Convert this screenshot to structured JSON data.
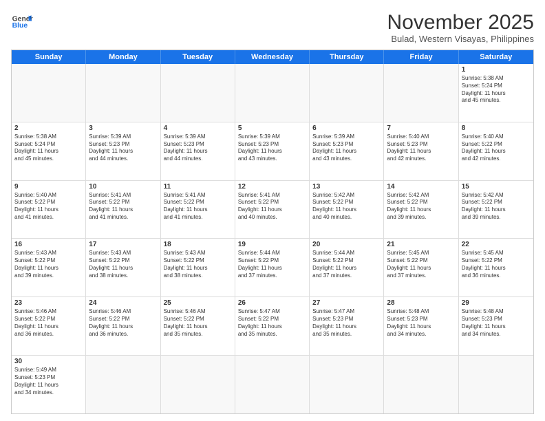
{
  "header": {
    "logo_general": "General",
    "logo_blue": "Blue",
    "month_title": "November 2025",
    "subtitle": "Bulad, Western Visayas, Philippines"
  },
  "weekdays": [
    "Sunday",
    "Monday",
    "Tuesday",
    "Wednesday",
    "Thursday",
    "Friday",
    "Saturday"
  ],
  "rows": [
    [
      {
        "day": "",
        "text": ""
      },
      {
        "day": "",
        "text": ""
      },
      {
        "day": "",
        "text": ""
      },
      {
        "day": "",
        "text": ""
      },
      {
        "day": "",
        "text": ""
      },
      {
        "day": "",
        "text": ""
      },
      {
        "day": "1",
        "text": "Sunrise: 5:38 AM\nSunset: 5:24 PM\nDaylight: 11 hours\nand 45 minutes."
      }
    ],
    [
      {
        "day": "2",
        "text": "Sunrise: 5:38 AM\nSunset: 5:24 PM\nDaylight: 11 hours\nand 45 minutes."
      },
      {
        "day": "3",
        "text": "Sunrise: 5:39 AM\nSunset: 5:23 PM\nDaylight: 11 hours\nand 44 minutes."
      },
      {
        "day": "4",
        "text": "Sunrise: 5:39 AM\nSunset: 5:23 PM\nDaylight: 11 hours\nand 44 minutes."
      },
      {
        "day": "5",
        "text": "Sunrise: 5:39 AM\nSunset: 5:23 PM\nDaylight: 11 hours\nand 43 minutes."
      },
      {
        "day": "6",
        "text": "Sunrise: 5:39 AM\nSunset: 5:23 PM\nDaylight: 11 hours\nand 43 minutes."
      },
      {
        "day": "7",
        "text": "Sunrise: 5:40 AM\nSunset: 5:23 PM\nDaylight: 11 hours\nand 42 minutes."
      },
      {
        "day": "8",
        "text": "Sunrise: 5:40 AM\nSunset: 5:22 PM\nDaylight: 11 hours\nand 42 minutes."
      }
    ],
    [
      {
        "day": "9",
        "text": "Sunrise: 5:40 AM\nSunset: 5:22 PM\nDaylight: 11 hours\nand 41 minutes."
      },
      {
        "day": "10",
        "text": "Sunrise: 5:41 AM\nSunset: 5:22 PM\nDaylight: 11 hours\nand 41 minutes."
      },
      {
        "day": "11",
        "text": "Sunrise: 5:41 AM\nSunset: 5:22 PM\nDaylight: 11 hours\nand 41 minutes."
      },
      {
        "day": "12",
        "text": "Sunrise: 5:41 AM\nSunset: 5:22 PM\nDaylight: 11 hours\nand 40 minutes."
      },
      {
        "day": "13",
        "text": "Sunrise: 5:42 AM\nSunset: 5:22 PM\nDaylight: 11 hours\nand 40 minutes."
      },
      {
        "day": "14",
        "text": "Sunrise: 5:42 AM\nSunset: 5:22 PM\nDaylight: 11 hours\nand 39 minutes."
      },
      {
        "day": "15",
        "text": "Sunrise: 5:42 AM\nSunset: 5:22 PM\nDaylight: 11 hours\nand 39 minutes."
      }
    ],
    [
      {
        "day": "16",
        "text": "Sunrise: 5:43 AM\nSunset: 5:22 PM\nDaylight: 11 hours\nand 39 minutes."
      },
      {
        "day": "17",
        "text": "Sunrise: 5:43 AM\nSunset: 5:22 PM\nDaylight: 11 hours\nand 38 minutes."
      },
      {
        "day": "18",
        "text": "Sunrise: 5:43 AM\nSunset: 5:22 PM\nDaylight: 11 hours\nand 38 minutes."
      },
      {
        "day": "19",
        "text": "Sunrise: 5:44 AM\nSunset: 5:22 PM\nDaylight: 11 hours\nand 37 minutes."
      },
      {
        "day": "20",
        "text": "Sunrise: 5:44 AM\nSunset: 5:22 PM\nDaylight: 11 hours\nand 37 minutes."
      },
      {
        "day": "21",
        "text": "Sunrise: 5:45 AM\nSunset: 5:22 PM\nDaylight: 11 hours\nand 37 minutes."
      },
      {
        "day": "22",
        "text": "Sunrise: 5:45 AM\nSunset: 5:22 PM\nDaylight: 11 hours\nand 36 minutes."
      }
    ],
    [
      {
        "day": "23",
        "text": "Sunrise: 5:46 AM\nSunset: 5:22 PM\nDaylight: 11 hours\nand 36 minutes."
      },
      {
        "day": "24",
        "text": "Sunrise: 5:46 AM\nSunset: 5:22 PM\nDaylight: 11 hours\nand 36 minutes."
      },
      {
        "day": "25",
        "text": "Sunrise: 5:46 AM\nSunset: 5:22 PM\nDaylight: 11 hours\nand 35 minutes."
      },
      {
        "day": "26",
        "text": "Sunrise: 5:47 AM\nSunset: 5:22 PM\nDaylight: 11 hours\nand 35 minutes."
      },
      {
        "day": "27",
        "text": "Sunrise: 5:47 AM\nSunset: 5:23 PM\nDaylight: 11 hours\nand 35 minutes."
      },
      {
        "day": "28",
        "text": "Sunrise: 5:48 AM\nSunset: 5:23 PM\nDaylight: 11 hours\nand 34 minutes."
      },
      {
        "day": "29",
        "text": "Sunrise: 5:48 AM\nSunset: 5:23 PM\nDaylight: 11 hours\nand 34 minutes."
      }
    ],
    [
      {
        "day": "30",
        "text": "Sunrise: 5:49 AM\nSunset: 5:23 PM\nDaylight: 11 hours\nand 34 minutes."
      },
      {
        "day": "",
        "text": ""
      },
      {
        "day": "",
        "text": ""
      },
      {
        "day": "",
        "text": ""
      },
      {
        "day": "",
        "text": ""
      },
      {
        "day": "",
        "text": ""
      },
      {
        "day": "",
        "text": ""
      }
    ]
  ]
}
